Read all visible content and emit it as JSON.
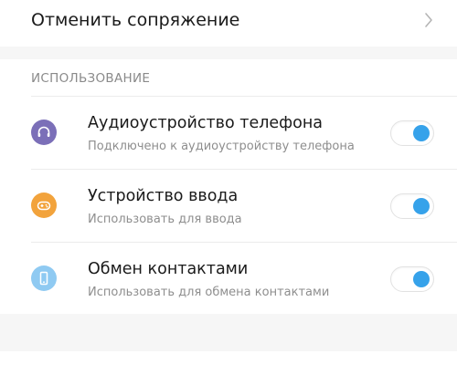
{
  "unpair": {
    "label": "Отменить сопряжение",
    "chevron_icon": "chevron-right-icon"
  },
  "usage": {
    "header": "ИСПОЛЬЗОВАНИЕ",
    "items": [
      {
        "title": "Аудиоустройство телефона",
        "subtitle": "Подключено к аудиоустройству телефона",
        "icon": "headset-icon",
        "icon_color": "#7b6fb8",
        "enabled": true
      },
      {
        "title": "Устройство ввода",
        "subtitle": "Использовать для ввода",
        "icon": "gamepad-icon",
        "icon_color": "#f2a33c",
        "enabled": true
      },
      {
        "title": "Обмен контактами",
        "subtitle": "Использовать для обмена контактами",
        "icon": "phone-icon",
        "icon_color": "#8fcaf2",
        "enabled": true
      }
    ]
  },
  "colors": {
    "toggle_on": "#36a2ea",
    "background": "#f6f6f6",
    "card": "#ffffff"
  }
}
